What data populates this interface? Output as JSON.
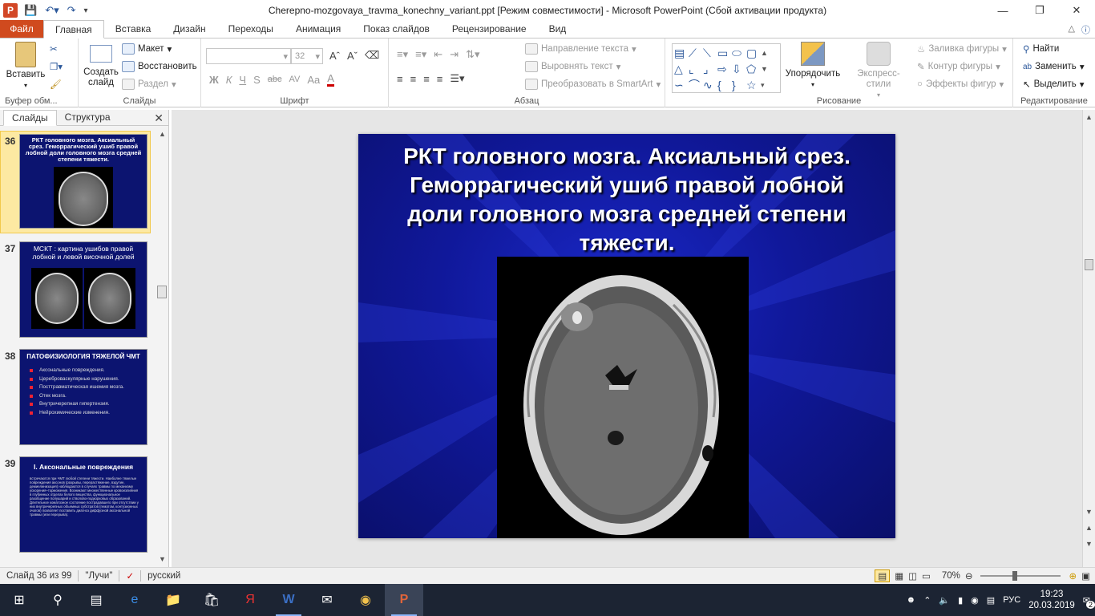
{
  "window": {
    "title": "Cherepno-mozgovaya_travma_konechny_variant.ppt [Режим совместимости]  -  Microsoft PowerPoint (Сбой активации продукта)",
    "app_icon": "P"
  },
  "ribbon_tabs": {
    "file": "Файл",
    "items": [
      "Главная",
      "Вставка",
      "Дизайн",
      "Переходы",
      "Анимация",
      "Показ слайдов",
      "Рецензирование",
      "Вид"
    ]
  },
  "ribbon": {
    "clipboard": {
      "paste": "Вставить",
      "label": "Буфер обм..."
    },
    "slides": {
      "new_slide": "Создать слайд",
      "layout": "Макет",
      "reset": "Восстановить",
      "section": "Раздел",
      "label": "Слайды"
    },
    "font": {
      "font_size": "32",
      "label": "Шрифт",
      "bold": "Ж",
      "italic": "К",
      "underline": "Ч",
      "shadow": "S",
      "strike": "abc",
      "spacing": "AV",
      "case": "Aa",
      "color": "A"
    },
    "paragraph": {
      "text_direction": "Направление текста",
      "align_text": "Выровнять текст",
      "smartart": "Преобразовать в SmartArt",
      "label": "Абзац"
    },
    "drawing": {
      "arrange": "Упорядочить",
      "quick_styles": "Экспресс-стили",
      "fill": "Заливка фигуры",
      "outline": "Контур фигуры",
      "effects": "Эффекты фигур",
      "label": "Рисование"
    },
    "editing": {
      "find": "Найти",
      "replace": "Заменить",
      "select": "Выделить",
      "label": "Редактирование"
    }
  },
  "panel": {
    "tab_slides": "Слайды",
    "tab_outline": "Структура",
    "thumbs": [
      {
        "num": "36",
        "title": "РКТ головного  мозга. Аксиальный срез. Геморрагический ушиб  правой лобной  доли  головного  мозга средней степени тяжести."
      },
      {
        "num": "37",
        "title": "МСКТ : картина ушибов правой лобной и левой височной долей"
      },
      {
        "num": "38",
        "title": "ПАТОФИЗИОЛОГИЯ ТЯЖЕЛОЙ ЧМТ",
        "bullets": [
          "Аксональные повреждения.",
          "Цереброваскулярные нарушения.",
          "Посттравматическая ишемия мозга.",
          "Отек мозга.",
          "Внутричерепная гипертензия.",
          "Нейрохимические изменения."
        ]
      },
      {
        "num": "39",
        "title": "I. Аксональные повреждения",
        "body": "встречаются  при  ЧМТ  любой  степени  тяжести. Наиболее тяжелые  повреждения аксонов (разрывы, перерастяжение, вздутие, демиелинизация) наблюдаются в случаях травмы по механизму ускорения–торможения. Возникают  множественные кровоизлияния в глубинных отделах белого вещества, функциональное разобщение полушарий и стволово-подкорковых образований. Длительное коматозное  состояние пострадавшего при отсутствии у них внутричерепных объемных субстратов (гематом, контузионных очагов) позволяет поставить диагноз диффузной аксональной травмы (или перерыва)."
      }
    ]
  },
  "slide": {
    "title": "РКТ головного мозга. Аксиальный срез. Геморрагический ушиб правой лобной доли головного мозга средней степени тяжести."
  },
  "statusbar": {
    "slide_info": "Слайд 36 из 99",
    "theme": "\"Лучи\"",
    "language": "русский",
    "zoom": "70%"
  },
  "taskbar": {
    "lang": "РУС",
    "time": "19:23",
    "date": "20.03.2019",
    "notifications": "2"
  },
  "colors": {
    "accent": "#d04a1e",
    "slide_bg": "#10189a"
  }
}
